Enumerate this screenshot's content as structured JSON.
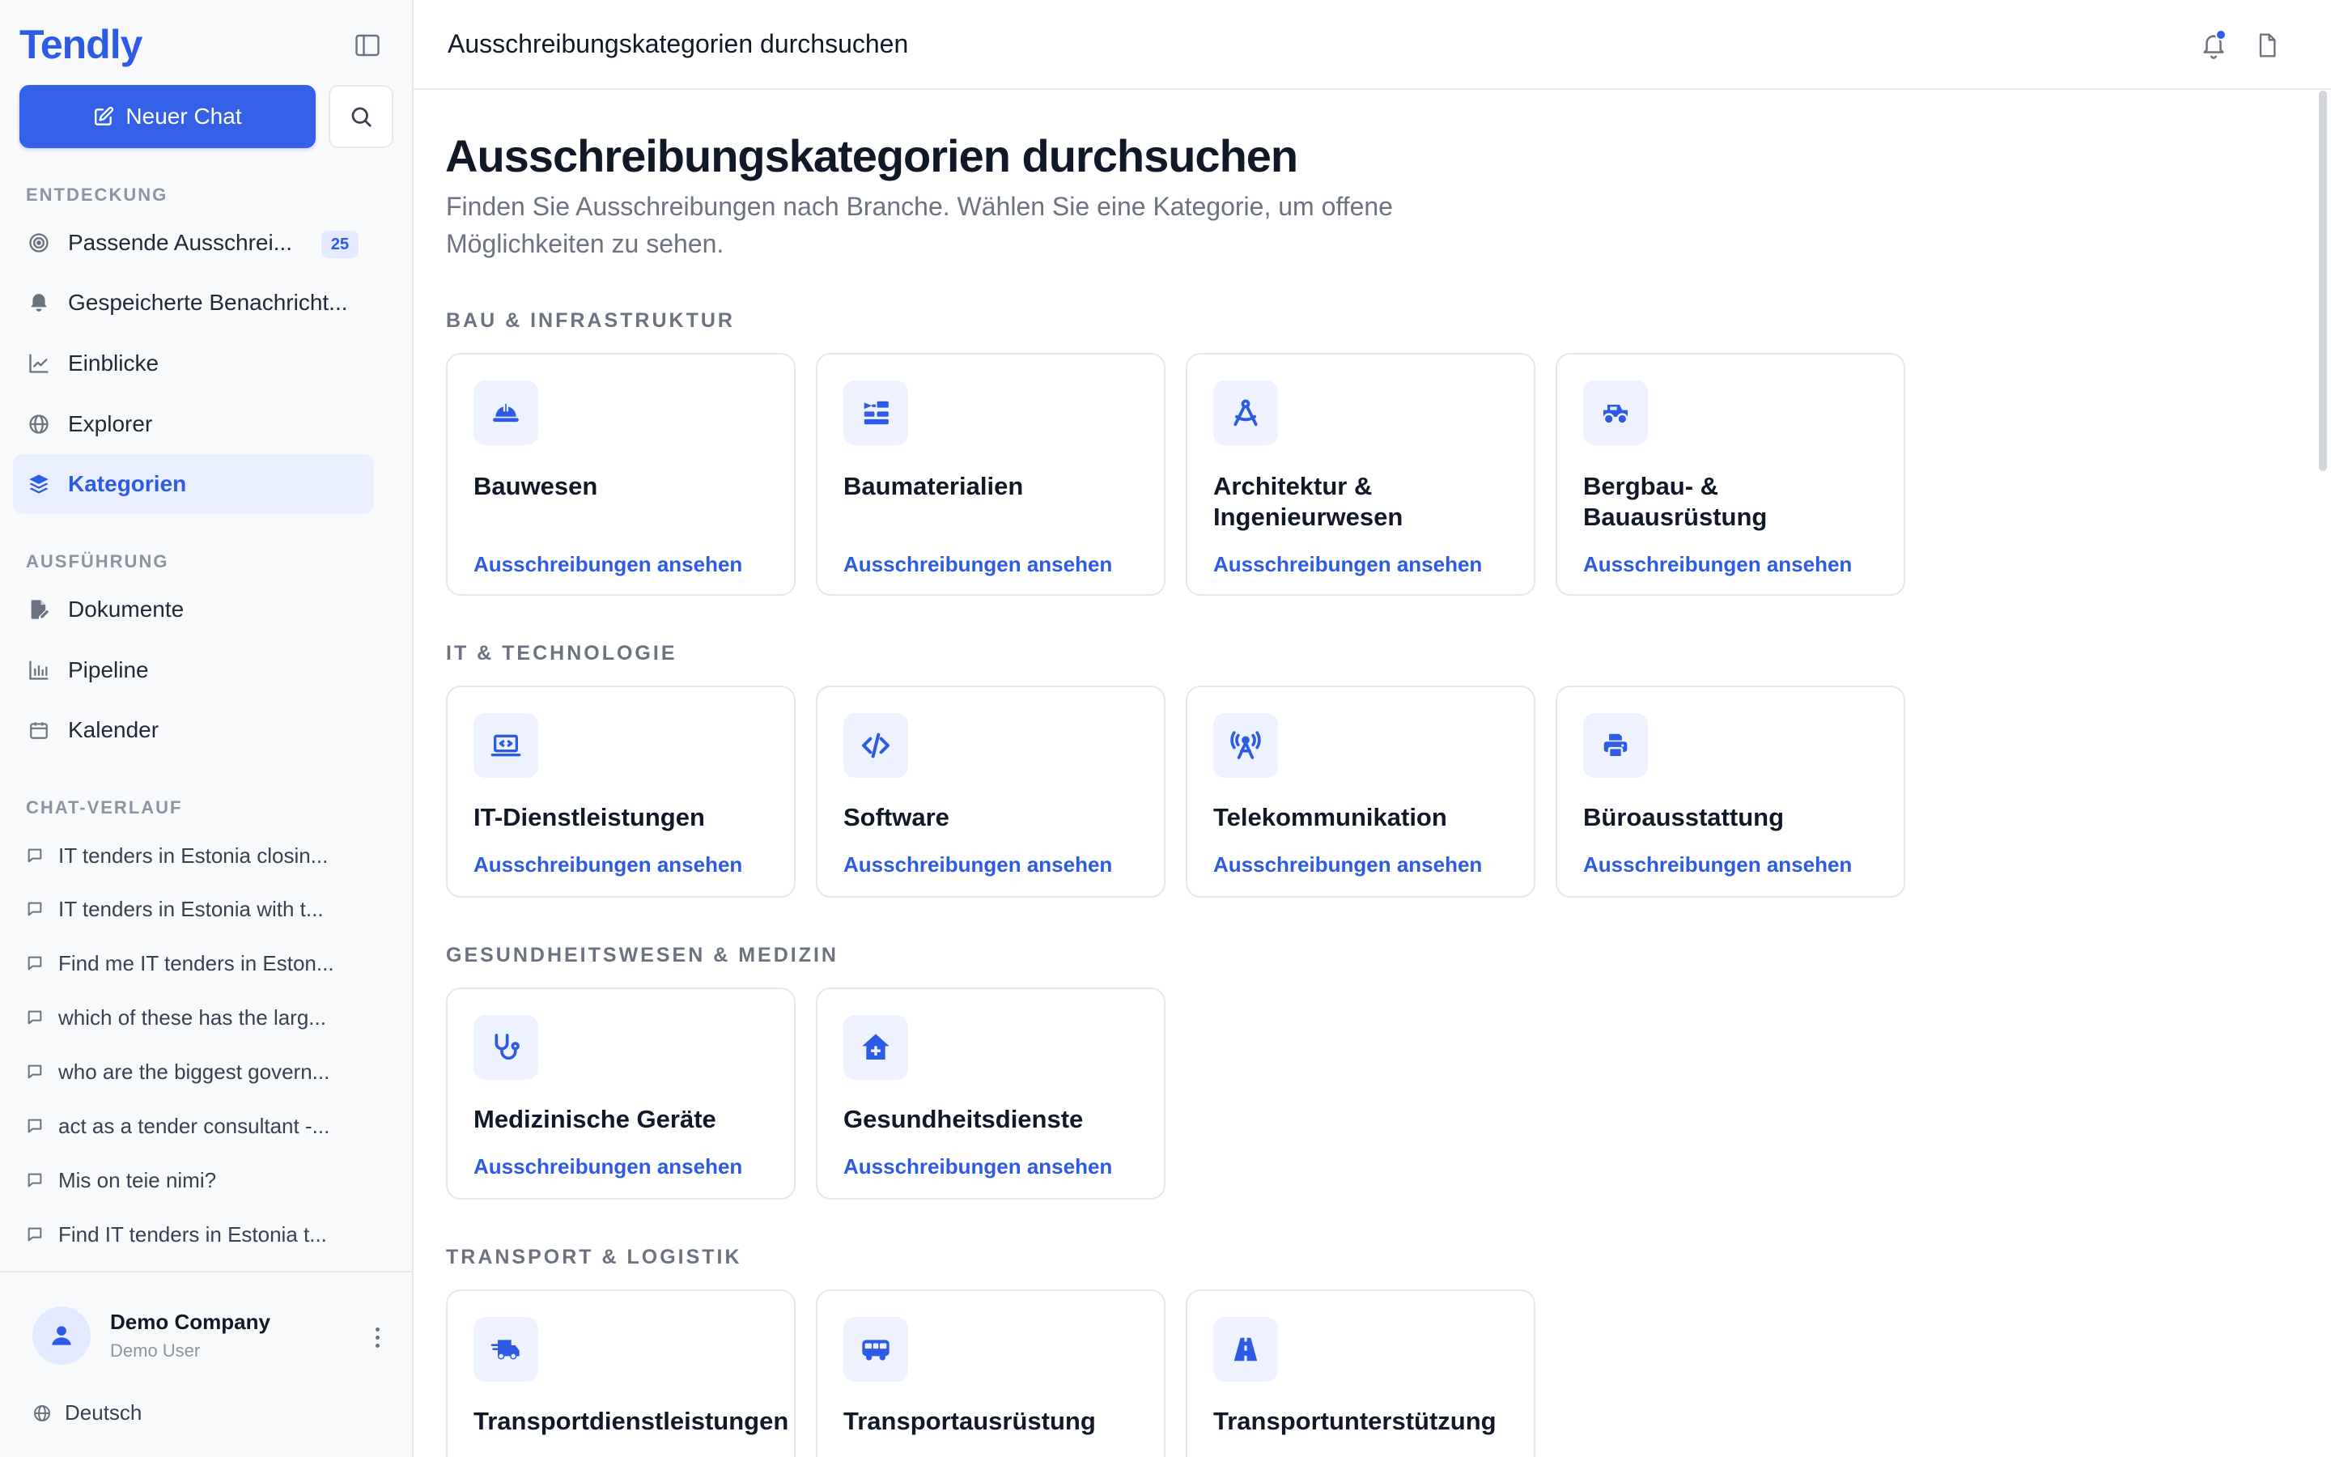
{
  "app": {
    "brand": "Tendly",
    "new_chat_label": "Neuer Chat"
  },
  "sidebar": {
    "sections": {
      "discovery": "ENTDECKUNG",
      "execution": "AUSFÜHRUNG",
      "history": "CHAT-VERLAUF"
    },
    "discovery_items": [
      {
        "label": "Passende Ausschrei...",
        "badge": "25"
      },
      {
        "label": "Gespeicherte Benachricht..."
      },
      {
        "label": "Einblicke"
      },
      {
        "label": "Explorer"
      },
      {
        "label": "Kategorien",
        "active": true
      }
    ],
    "execution_items": [
      {
        "label": "Dokumente"
      },
      {
        "label": "Pipeline"
      },
      {
        "label": "Kalender"
      }
    ],
    "chat_history": [
      "IT tenders in Estonia closin...",
      "IT tenders in Estonia with t...",
      "Find me IT tenders in Eston...",
      "which of these has the larg...",
      "who are the biggest govern...",
      "act as a tender consultant -...",
      "Mis on teie nimi?",
      "Find IT tenders in Estonia t..."
    ],
    "footer": {
      "company": "Demo Company",
      "user": "Demo User",
      "language": "Deutsch"
    }
  },
  "header": {
    "title": "Ausschreibungskategorien durchsuchen"
  },
  "main": {
    "title": "Ausschreibungskategorien durchsuchen",
    "subtitle": "Finden Sie Ausschreibungen nach Branche. Wählen Sie eine Kategorie, um offene Möglichkeiten zu sehen.",
    "link_label": "Ausschreibungen ansehen",
    "categories": [
      {
        "label": "BAU & INFRASTRUKTUR",
        "cards": [
          {
            "title": "Bauwesen",
            "icon": "hard-hat-icon"
          },
          {
            "title": "Baumaterialien",
            "icon": "trowel-bricks-icon"
          },
          {
            "title": "Architektur & Ingenieurwesen",
            "icon": "compass-drafting-icon"
          },
          {
            "title": "Bergbau- & Bauausrüstung",
            "icon": "heavy-vehicle-icon"
          }
        ]
      },
      {
        "label": "IT & TECHNOLOGIE",
        "cards": [
          {
            "title": "IT-Dienstleistungen",
            "icon": "laptop-code-icon"
          },
          {
            "title": "Software",
            "icon": "code-icon"
          },
          {
            "title": "Telekommunikation",
            "icon": "tower-broadcast-icon"
          },
          {
            "title": "Büroausstattung",
            "icon": "printer-icon"
          }
        ]
      },
      {
        "label": "GESUNDHEITSWESEN & MEDIZIN",
        "cards": [
          {
            "title": "Medizinische Geräte",
            "icon": "stethoscope-icon"
          },
          {
            "title": "Gesundheitsdienste",
            "icon": "house-medical-icon"
          }
        ]
      },
      {
        "label": "TRANSPORT & LOGISTIK",
        "cards": [
          {
            "title": "Transportdienstleistungen",
            "icon": "truck-fast-icon"
          },
          {
            "title": "Transportausrüstung",
            "icon": "bus-icon"
          },
          {
            "title": "Transportunterstützung",
            "icon": "road-icon"
          }
        ]
      }
    ]
  },
  "colors": {
    "accent": "#2d5be3",
    "button": "#3461e8",
    "icon_bg": "#eef2ff",
    "muted": "#6b7280"
  }
}
